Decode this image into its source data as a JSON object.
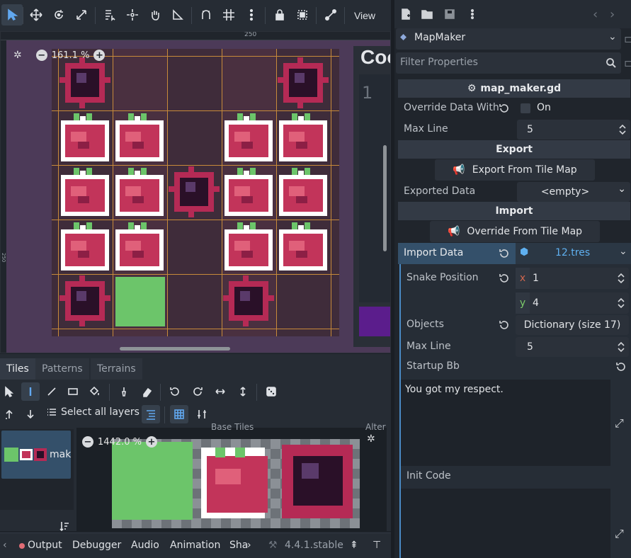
{
  "toolbar": {
    "view_label": "View",
    "icons": [
      "select-icon",
      "move-icon",
      "rotate-icon",
      "scale-icon",
      "list-select-icon",
      "pivot-icon",
      "pan-icon",
      "ruler-icon",
      "smart-snap-icon",
      "grid-snap-icon",
      "more-icon",
      "lock-icon",
      "group-icon",
      "bone-icon"
    ]
  },
  "canvas": {
    "zoom_text": "161.1 %",
    "ruler_top_mark": "250",
    "ruler_left_mark": "250",
    "side_title": "Coo",
    "side_number": "1",
    "colors": {
      "background": "#4c3a58",
      "level": "#3f2c3a",
      "grid": "#c88a3a",
      "strawberry_red": "#c2345a",
      "leaf_green": "#6cc56a",
      "spider_dark": "#2a1028"
    }
  },
  "bottom_panel": {
    "tabs": [
      "Tiles",
      "Patterns",
      "Terrains"
    ],
    "active_tab": "Tiles",
    "select_all_layers": "Select all layers",
    "source_label": "mak",
    "atlas_zoom": "1442.0 %",
    "atlas_header": "Base Tiles",
    "atlas_alt": "Alter"
  },
  "status_bar": {
    "output": "Output",
    "debugger": "Debugger",
    "audio": "Audio",
    "animation": "Animation",
    "shader": "Sha",
    "version": "4.4.1.stable"
  },
  "inspector": {
    "object_name": "MapMaker",
    "filter_placeholder": "Filter Properties",
    "script_name": "map_maker.gd",
    "override_data_with": {
      "label": "Override Data With",
      "value": "On"
    },
    "max_line_top": {
      "label": "Max Line",
      "value": "5"
    },
    "export_header": "Export",
    "export_button": "Export From Tile Map",
    "exported_data": {
      "label": "Exported Data",
      "value": "<empty>"
    },
    "import_header": "Import",
    "import_button": "Override From Tile Map",
    "import_data": {
      "label": "Import Data",
      "value": "12.tres"
    },
    "snake_position": {
      "label": "Snake Position",
      "x_label": "x",
      "x": "1",
      "y_label": "y",
      "y": "4"
    },
    "objects": {
      "label": "Objects",
      "value": "Dictionary (size 17)"
    },
    "max_line_inner": {
      "label": "Max Line",
      "value": "5"
    },
    "startup_bb": {
      "label": "Startup Bb",
      "value": "You got my respect."
    },
    "init_code": {
      "label": "Init Code",
      "value": ""
    }
  }
}
